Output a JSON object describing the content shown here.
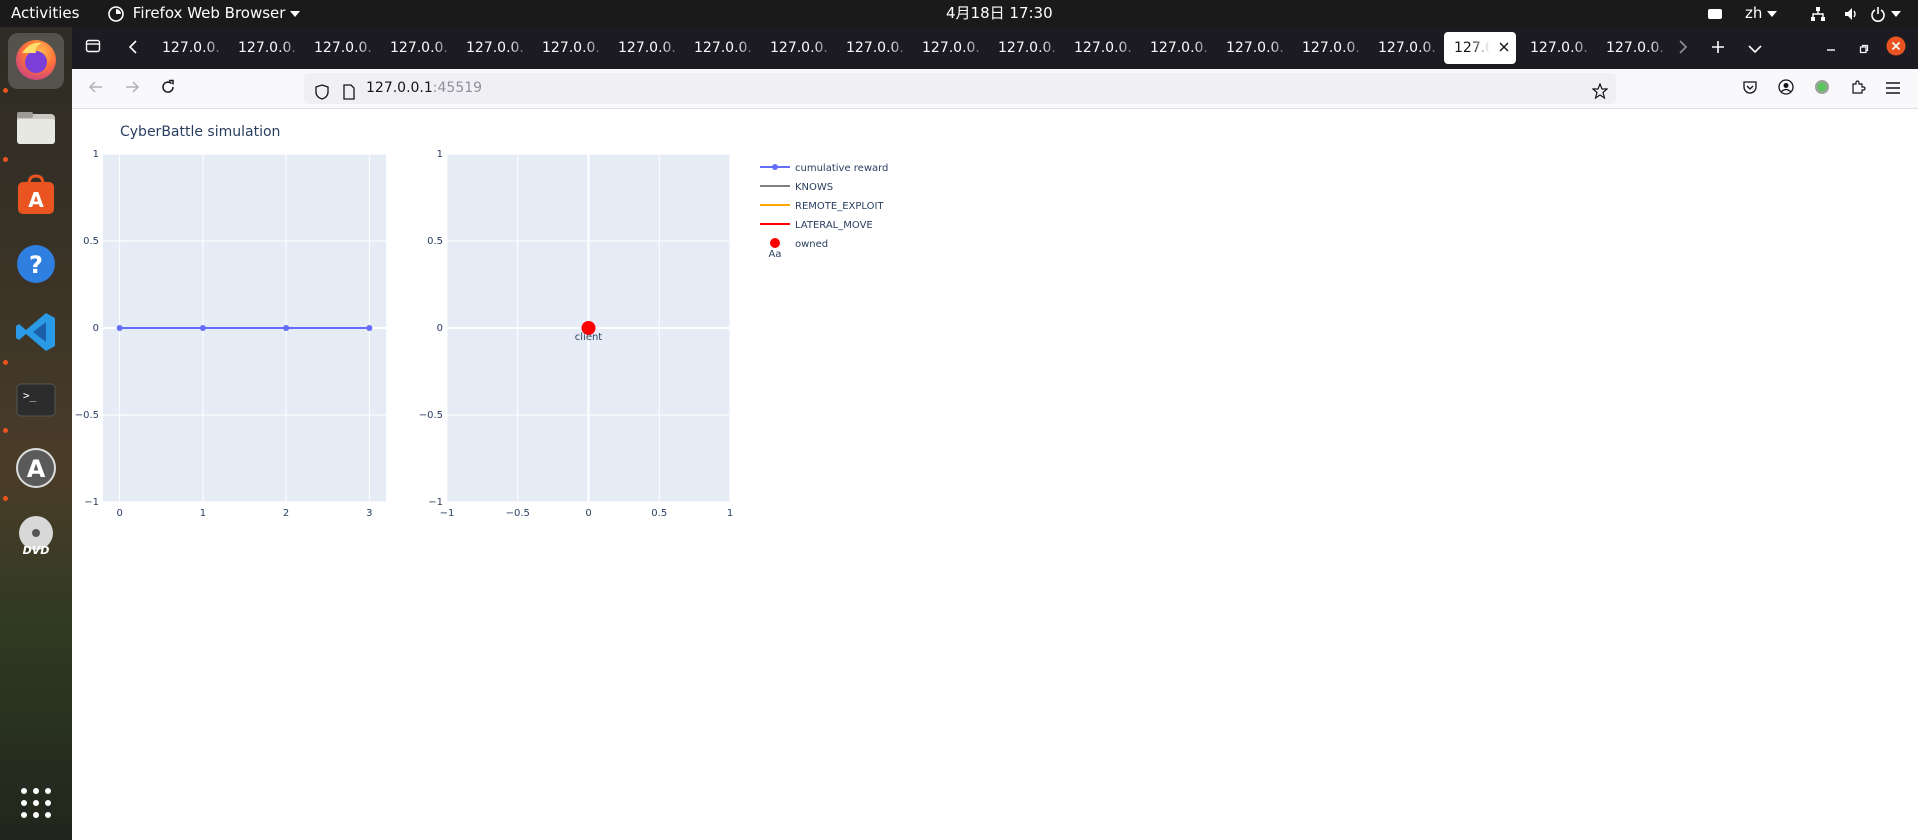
{
  "topbar": {
    "activities": "Activities",
    "app_menu": "Firefox Web Browser",
    "clock": "4月18日  17:30",
    "input_method": "zh"
  },
  "dock": {
    "apps": [
      {
        "name": "firefox",
        "active": true,
        "running": true
      },
      {
        "name": "files",
        "running": true
      },
      {
        "name": "app-center",
        "running": false
      },
      {
        "name": "help",
        "running": false
      },
      {
        "name": "vscode",
        "running": true
      },
      {
        "name": "terminal",
        "running": true
      },
      {
        "name": "software-updater",
        "running": true
      },
      {
        "name": "dvd",
        "running": false
      }
    ],
    "grid_icon": "app-grid-icon"
  },
  "browser": {
    "tabs": [
      {
        "title": "127.0.0."
      },
      {
        "title": "127.0.0."
      },
      {
        "title": "127.0.0."
      },
      {
        "title": "127.0.0."
      },
      {
        "title": "127.0.0."
      },
      {
        "title": "127.0.0."
      },
      {
        "title": "127.0.0."
      },
      {
        "title": "127.0.0."
      },
      {
        "title": "127.0.0."
      },
      {
        "title": "127.0.0."
      },
      {
        "title": "127.0.0."
      },
      {
        "title": "127.0.0."
      },
      {
        "title": "127.0.0."
      },
      {
        "title": "127.0.0."
      },
      {
        "title": "127.0.0."
      },
      {
        "title": "127.0.0."
      },
      {
        "title": "127.0.0."
      },
      {
        "title": "127.0",
        "selected": true
      },
      {
        "title": "127.0.0."
      },
      {
        "title": "127.0.0."
      }
    ],
    "url_host": "127.0.0.1",
    "url_port": ":45519"
  },
  "page": {
    "title": "CyberBattle simulation"
  },
  "chart_data": [
    {
      "type": "line",
      "title": "CyberBattle simulation",
      "x": [
        0,
        1,
        2,
        3
      ],
      "series": [
        {
          "name": "cumulative reward",
          "values": [
            0,
            0,
            0,
            0
          ],
          "color": "#636efa"
        }
      ],
      "xticks": [
        "0",
        "1",
        "2",
        "3"
      ],
      "yticks": [
        "−1",
        "−0.5",
        "0",
        "0.5",
        "1"
      ],
      "xlim": [
        -0.2,
        3.2
      ],
      "ylim": [
        -1,
        1
      ],
      "grid": true
    },
    {
      "type": "scatter",
      "points": [
        {
          "x": 0,
          "y": 0,
          "label": "client",
          "color": "#ff0000"
        }
      ],
      "xticks": [
        "−1",
        "−0.5",
        "0",
        "0.5",
        "1"
      ],
      "yticks": [
        "−1",
        "−0.5",
        "0",
        "0.5",
        "1"
      ],
      "xlim": [
        -1,
        1
      ],
      "ylim": [
        -1,
        1
      ],
      "grid": true
    }
  ],
  "legend": {
    "entries": [
      {
        "name": "cumulative reward",
        "kind": "line-marker",
        "color": "#636efa"
      },
      {
        "name": "KNOWS",
        "kind": "line",
        "color": "#808080"
      },
      {
        "name": "REMOTE_EXPLOIT",
        "kind": "line",
        "color": "#ffa500"
      },
      {
        "name": "LATERAL_MOVE",
        "kind": "line",
        "color": "#ff0000"
      },
      {
        "name": "owned",
        "kind": "marker",
        "color": "#ff0000",
        "sublabel": "Aa"
      }
    ]
  },
  "colors": {
    "plot_bg": "#e5ecf6",
    "axis_text": "#2a3f5f",
    "ubuntu_orange": "#e95420"
  }
}
